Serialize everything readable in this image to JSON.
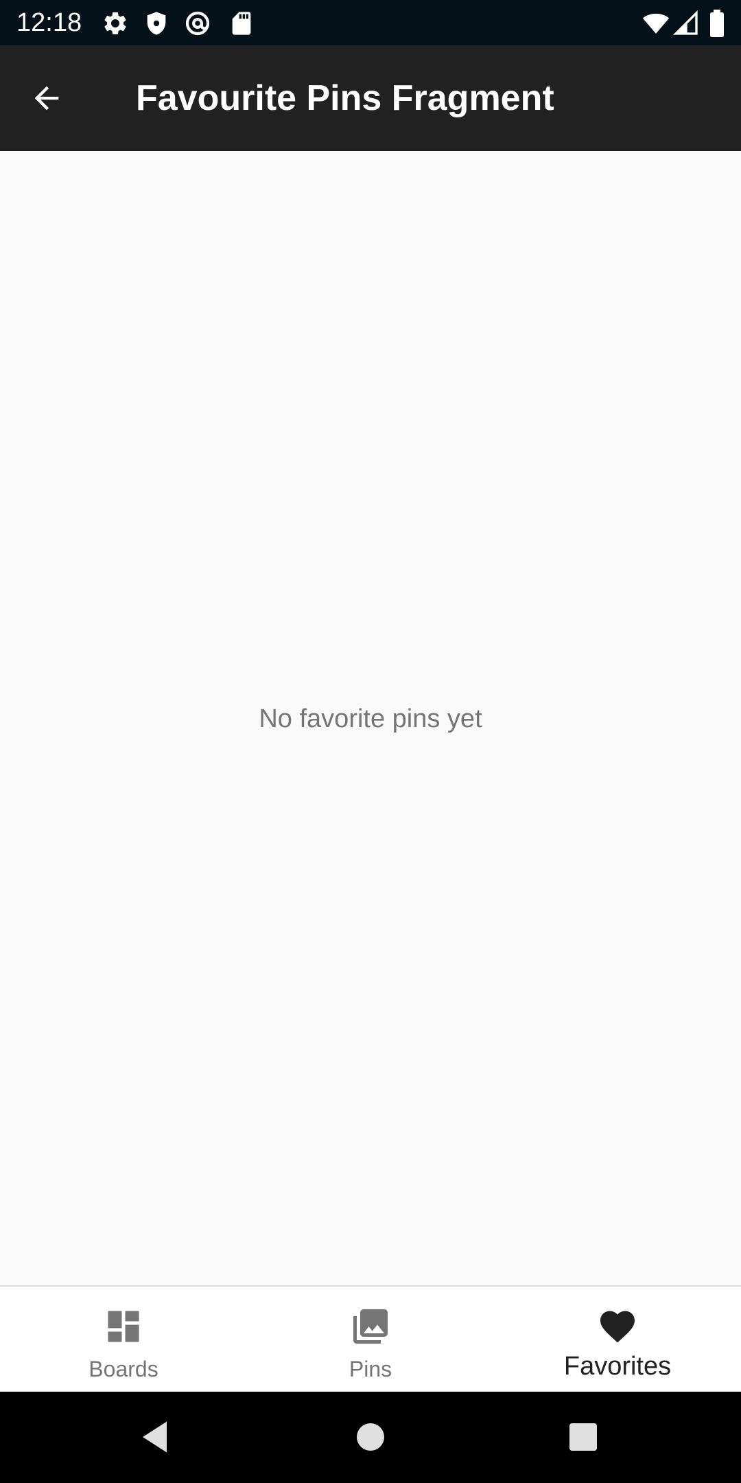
{
  "status_bar": {
    "time": "12:18",
    "icons": [
      "gear-icon",
      "shield-icon",
      "at-sign-icon",
      "sd-card-icon",
      "wifi-icon",
      "signal-icon",
      "battery-icon"
    ]
  },
  "app_bar": {
    "title": "Favourite Pins Fragment",
    "back_icon": "arrow-back-icon"
  },
  "content": {
    "empty_message": "No favorite pins yet"
  },
  "bottom_nav": {
    "items": [
      {
        "label": "Boards",
        "icon": "dashboard-icon",
        "active": false
      },
      {
        "label": "Pins",
        "icon": "photo-library-icon",
        "active": false
      },
      {
        "label": "Favorites",
        "icon": "heart-icon",
        "active": true
      }
    ]
  },
  "system_nav": {
    "buttons": [
      "back-triangle-icon",
      "home-circle-icon",
      "recents-square-icon"
    ]
  },
  "colors": {
    "status_bar_bg": "#051118",
    "app_bar_bg": "#212121",
    "content_bg": "#fafafa",
    "inactive_nav": "#757575",
    "active_nav": "#212121",
    "system_nav_bg": "#000000"
  }
}
